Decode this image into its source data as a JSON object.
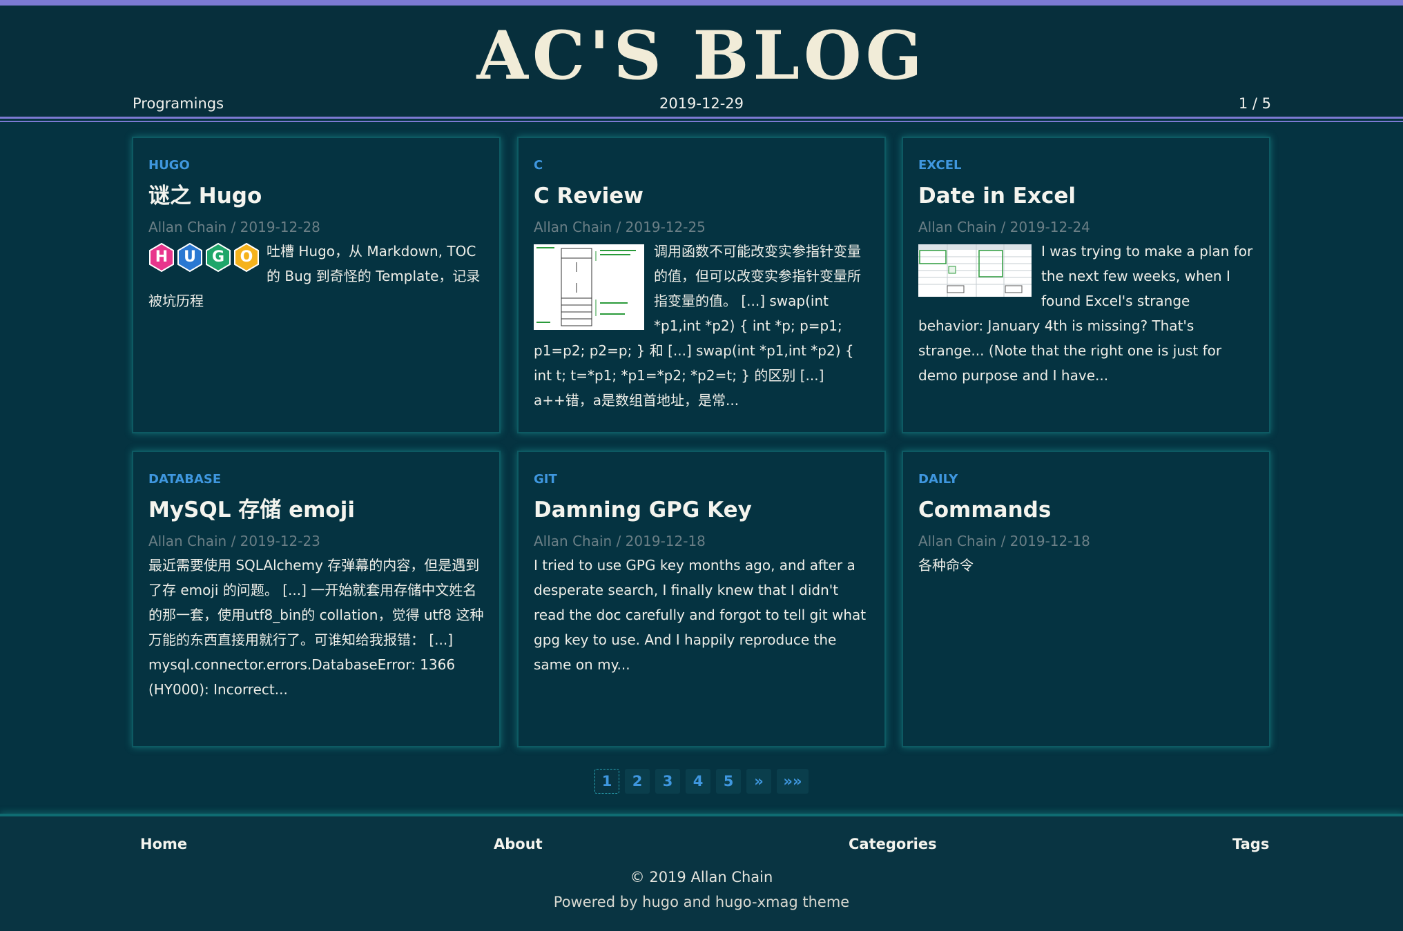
{
  "site": {
    "title": "AC'S BLOG",
    "section": "Programings",
    "date": "2019-12-29",
    "page_indicator": "1 / 5"
  },
  "posts": [
    {
      "category": "HUGO",
      "title": "谜之 Hugo",
      "byline": "Allan Chain / 2019-12-28",
      "summary": "吐槽 Hugo，从 Markdown, TOC 的 Bug 到奇怪的 Template，记录被坑历程",
      "thumb_letters": [
        "H",
        "U",
        "G",
        "O"
      ],
      "thumb_colors": [
        "#e8358c",
        "#2a78d2",
        "#1fa66a",
        "#f5b21c"
      ]
    },
    {
      "category": "C",
      "title": "C Review",
      "byline": "Allan Chain / 2019-12-25",
      "summary": "调用函数不可能改变实参指针变量的值，但可以改变实参指针变量所指变量的值。 [...] swap(int *p1,int *p2) { int *p; p=p1; p1=p2; p2=p; } 和 [...] swap(int *p1,int *p2) { int t; t=*p1; *p1=*p2; *p2=t; } 的区别 [...] a++错，a是数组首地址，是常..."
    },
    {
      "category": "EXCEL",
      "title": "Date in Excel",
      "byline": "Allan Chain / 2019-12-24",
      "summary": "I was trying to make a plan for the next few weeks, when I found Excel's strange behavior: January 4th is missing? That's strange... (Note that the right one is just for demo purpose and I have..."
    },
    {
      "category": "DATABASE",
      "title": "MySQL 存储 emoji",
      "byline": "Allan Chain / 2019-12-23",
      "summary": "最近需要使用 SQLAlchemy 存弹幕的内容，但是遇到了存 emoji 的问题。 [...] 一开始就套用存储中文姓名的那一套，使用utf8_bin的 collation，觉得 utf8 这种万能的东西直接用就行了。可谁知给我报错： [...] mysql.connector.errors.DatabaseError: 1366 (HY000): Incorrect..."
    },
    {
      "category": "GIT",
      "title": "Damning GPG Key",
      "byline": "Allan Chain / 2019-12-18",
      "summary": "I tried to use GPG key months ago, and after a desperate search, I finally knew that I didn't read the doc carefully and forgot to tell git what gpg key to use. And I happily reproduce the same on my..."
    },
    {
      "category": "DAILY",
      "title": "Commands",
      "byline": "Allan Chain / 2019-12-18",
      "summary": "各种命令"
    }
  ],
  "pagination": {
    "pages": [
      "1",
      "2",
      "3",
      "4",
      "5"
    ],
    "next": "»",
    "last": "»»",
    "current": "1"
  },
  "footer": {
    "nav": [
      "Home",
      "About",
      "Categories",
      "Tags"
    ],
    "copyright": "© 2019 Allan Chain",
    "powered": "Powered by hugo and hugo-xmag theme"
  },
  "colors": {
    "accent": "#7c7ad3",
    "link": "#3f97df",
    "background": "#053341"
  }
}
